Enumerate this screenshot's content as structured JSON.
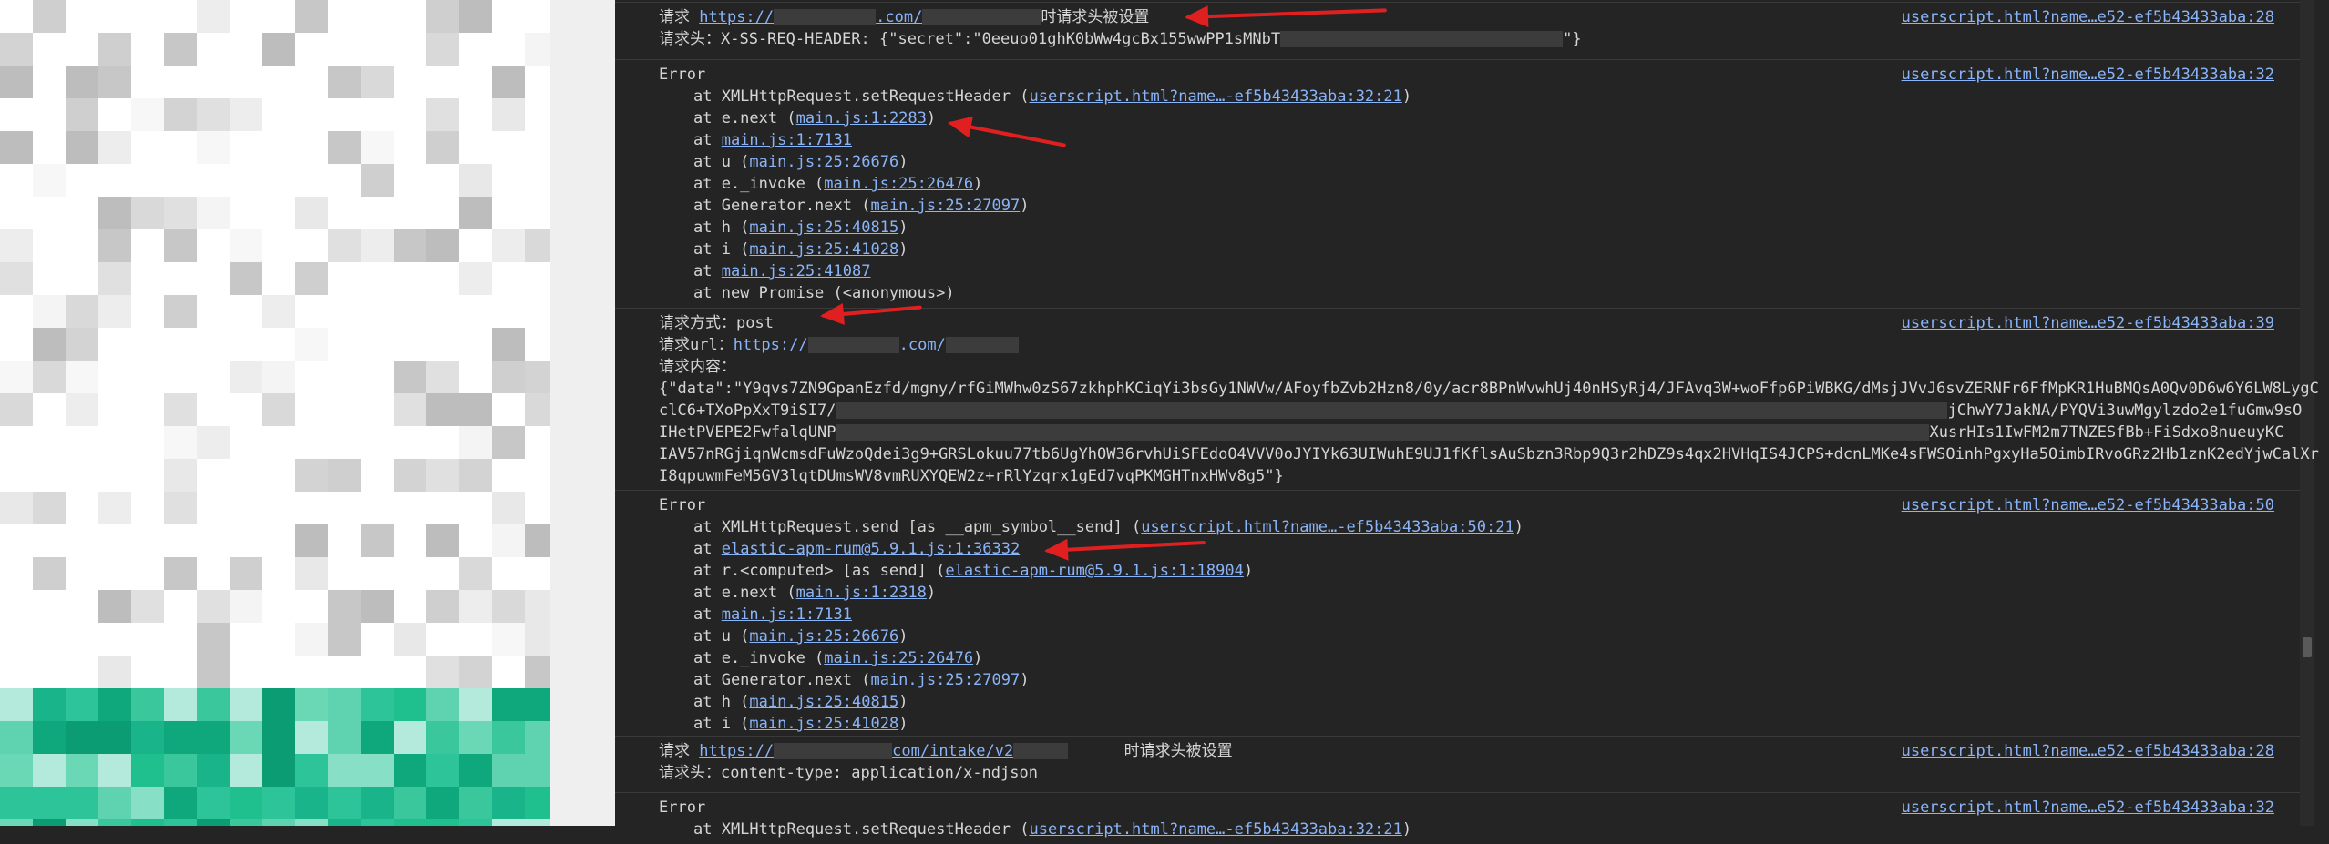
{
  "mosaic_colors": [
    "#e8e8e8",
    "#cfcfcf",
    "#f4f4f4",
    "#d9d9d9",
    "#bdbdbd",
    "#ededed",
    "#c7c7c7",
    "#e0e0e0",
    "#f7f7f7",
    "#d3d3d3"
  ],
  "mosaic_green": [
    "#1ab48a",
    "#2ec49a",
    "#5fd3b0",
    "#0fa77c",
    "#87e0c5",
    "#39c79b",
    "#1fc08d",
    "#b3eadb",
    "#6bd8b5",
    "#0c9c73"
  ],
  "blocks": [
    {
      "lines": [
        {
          "parts": [
            {
              "t": "请求 "
            },
            {
              "t": "https://",
              "link": true
            },
            {
              "mask": 112
            },
            {
              "t": ".com/",
              "link": true
            },
            {
              "mask": 130
            },
            {
              "t": "时请求头被设置"
            }
          ],
          "src": "userscript.html?name…e52-ef5b43433aba:28"
        },
        {
          "parts": [
            {
              "t": "请求头：X-SS-REQ-HEADER: {\"secret\":\"0eeuo01ghK0bWw4gcBx155wwPP1sMNbT"
            },
            {
              "mask": 310
            },
            {
              "t": "\"}"
            }
          ]
        }
      ]
    },
    {
      "lines": [
        {
          "parts": [
            {
              "t": "Error"
            }
          ],
          "src": "userscript.html?name…e52-ef5b43433aba:32"
        },
        {
          "indent": true,
          "parts": [
            {
              "t": "at XMLHttpRequest.setRequestHeader ("
            },
            {
              "t": "userscript.html?name…-ef5b43433aba:32:21",
              "link": true
            },
            {
              "t": ")"
            }
          ]
        },
        {
          "indent": true,
          "parts": [
            {
              "t": "at e.next ("
            },
            {
              "t": "main.js:1:2283",
              "link": true
            },
            {
              "t": ")"
            }
          ]
        },
        {
          "indent": true,
          "parts": [
            {
              "t": "at "
            },
            {
              "t": "main.js:1:7131",
              "link": true
            }
          ]
        },
        {
          "indent": true,
          "parts": [
            {
              "t": "at u ("
            },
            {
              "t": "main.js:25:26676",
              "link": true
            },
            {
              "t": ")"
            }
          ]
        },
        {
          "indent": true,
          "parts": [
            {
              "t": "at e._invoke ("
            },
            {
              "t": "main.js:25:26476",
              "link": true
            },
            {
              "t": ")"
            }
          ]
        },
        {
          "indent": true,
          "parts": [
            {
              "t": "at Generator.next ("
            },
            {
              "t": "main.js:25:27097",
              "link": true
            },
            {
              "t": ")"
            }
          ]
        },
        {
          "indent": true,
          "parts": [
            {
              "t": "at h ("
            },
            {
              "t": "main.js:25:40815",
              "link": true
            },
            {
              "t": ")"
            }
          ]
        },
        {
          "indent": true,
          "parts": [
            {
              "t": "at i ("
            },
            {
              "t": "main.js:25:41028",
              "link": true
            },
            {
              "t": ")"
            }
          ]
        },
        {
          "indent": true,
          "parts": [
            {
              "t": "at "
            },
            {
              "t": "main.js:25:41087",
              "link": true
            }
          ]
        },
        {
          "indent": true,
          "parts": [
            {
              "t": "at new Promise (<anonymous>)"
            }
          ]
        }
      ]
    },
    {
      "lines": [
        {
          "parts": [
            {
              "t": "请求方式：post"
            }
          ],
          "src": "userscript.html?name…e52-ef5b43433aba:39"
        },
        {
          "parts": [
            {
              "t": "请求url：https://",
              "linkTail": true
            },
            {
              "mask": 100
            },
            {
              "t": ".com/",
              "link": true
            },
            {
              "mask": 80
            }
          ]
        },
        {
          "parts": [
            {
              "t": "请求内容："
            }
          ]
        },
        {
          "parts": [
            {
              "t": "{\"data\":\"Y9qvs7ZN9GpanEzfd/mgny/rfGiMWhw0zS67zkhphKCiqYi3bsGy1NWVw/AFoyfbZvb2Hzn8/0y/acr8BPnWvwhUj40nHSyRj4/JFAvq3W+woFfp6PiWBKG/dMsjJVvJ6svZERNFr6FfMpKR1HuBMQsA0Qv0D6w6Y6LW8LygC"
            }
          ]
        },
        {
          "parts": [
            {
              "t": "clC6+TXoPpXxT9iSI7/"
            },
            {
              "mask": 1220
            },
            {
              "t": "jChwY7JakNA/PYQVi3uwMgylzdo2e1fuGmw9sO"
            }
          ]
        },
        {
          "parts": [
            {
              "t": "IHetPVEPE2FwfalqUNP"
            },
            {
              "mask": 1200
            },
            {
              "t": "XusrHIs1IwFM2m7TNZESfBb+FiSdxo8nueuyKC"
            }
          ]
        },
        {
          "parts": [
            {
              "t": "IAV57nRGjiqnWcmsdFuWzoQdei3g9+GRSLokuu77tb6UgYhOW36rvhUiSFEdoO4VVV0oJYIYk63UIWuhE9UJ1fKflsAuSbzn3Rbp9Q3r2hDZ9s4qx2HVHqIS4JCPS+dcnLMKe4sFWSOinhPgxyHa5OimbIRvoGRz2Hb1znK2edYjwCalXr"
            }
          ]
        },
        {
          "parts": [
            {
              "t": "I8qpuwmFeM5GV3lqtDUmsWV8vmRUXYQEW2z+rRlYzqrx1gEd7vqPKMGHTnxHWv8g5\"}"
            }
          ]
        }
      ]
    },
    {
      "lines": [
        {
          "parts": [
            {
              "t": "Error"
            }
          ],
          "src": "userscript.html?name…e52-ef5b43433aba:50"
        },
        {
          "indent": true,
          "parts": [
            {
              "t": "at XMLHttpRequest.send [as __apm_symbol__send] ("
            },
            {
              "t": "userscript.html?name…-ef5b43433aba:50:21",
              "link": true
            },
            {
              "t": ")"
            }
          ]
        },
        {
          "indent": true,
          "parts": [
            {
              "t": "at "
            },
            {
              "t": "elastic-apm-rum@5.9.1.js:1:36332",
              "link": true
            }
          ]
        },
        {
          "indent": true,
          "parts": [
            {
              "t": "at r.<computed> [as send] ("
            },
            {
              "t": "elastic-apm-rum@5.9.1.js:1:18904",
              "link": true
            },
            {
              "t": ")"
            }
          ]
        },
        {
          "indent": true,
          "parts": [
            {
              "t": "at e.next ("
            },
            {
              "t": "main.js:1:2318",
              "link": true
            },
            {
              "t": ")"
            }
          ]
        },
        {
          "indent": true,
          "parts": [
            {
              "t": "at "
            },
            {
              "t": "main.js:1:7131",
              "link": true
            }
          ]
        },
        {
          "indent": true,
          "parts": [
            {
              "t": "at u ("
            },
            {
              "t": "main.js:25:26676",
              "link": true
            },
            {
              "t": ")"
            }
          ]
        },
        {
          "indent": true,
          "parts": [
            {
              "t": "at e._invoke ("
            },
            {
              "t": "main.js:25:26476",
              "link": true
            },
            {
              "t": ")"
            }
          ]
        },
        {
          "indent": true,
          "parts": [
            {
              "t": "at Generator.next ("
            },
            {
              "t": "main.js:25:27097",
              "link": true
            },
            {
              "t": ")"
            }
          ]
        },
        {
          "indent": true,
          "parts": [
            {
              "t": "at h ("
            },
            {
              "t": "main.js:25:40815",
              "link": true
            },
            {
              "t": ")"
            }
          ]
        },
        {
          "indent": true,
          "parts": [
            {
              "t": "at i ("
            },
            {
              "t": "main.js:25:41028",
              "link": true
            },
            {
              "t": ")"
            }
          ]
        }
      ]
    },
    {
      "lines": [
        {
          "parts": [
            {
              "t": "请求 "
            },
            {
              "t": "https://",
              "link": true
            },
            {
              "mask": 130
            },
            {
              "t": "com/intake/v2",
              "link": true
            },
            {
              "mask": 60
            },
            {
              "t": "      时请求头被设置"
            }
          ],
          "src": "userscript.html?name…e52-ef5b43433aba:28"
        },
        {
          "parts": [
            {
              "t": "请求头：content-type: application/x-ndjson"
            }
          ]
        }
      ]
    },
    {
      "lines": [
        {
          "parts": [
            {
              "t": "Error"
            }
          ],
          "src": "userscript.html?name…e52-ef5b43433aba:32"
        },
        {
          "indent": true,
          "parts": [
            {
              "t": "at XMLHttpRequest.setRequestHeader ("
            },
            {
              "t": "userscript.html?name…-ef5b43433aba:32:21",
              "link": true
            },
            {
              "t": ")"
            }
          ]
        }
      ]
    }
  ]
}
